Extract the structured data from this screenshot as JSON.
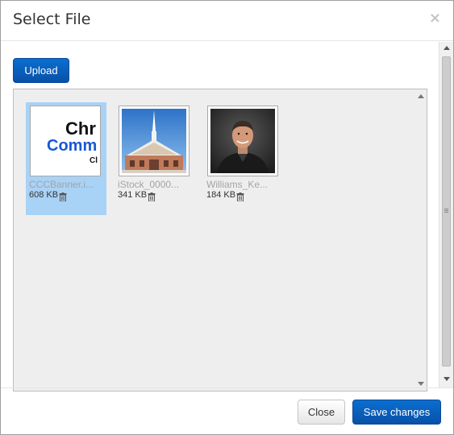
{
  "dialog": {
    "title": "Select File",
    "close_glyph": "×"
  },
  "toolbar": {
    "upload_label": "Upload"
  },
  "files": [
    {
      "name": "CCCBanner.i...",
      "size": "608 KB",
      "selected": true,
      "thumb_icon": "banner-image",
      "thumb_text_line1": "Chr",
      "thumb_text_line2": "Comm",
      "thumb_text_line3": "Cl"
    },
    {
      "name": "iStock_0000...",
      "size": "341 KB",
      "selected": false,
      "thumb_icon": "church-photo"
    },
    {
      "name": "Williams_Ke...",
      "size": "184 KB",
      "selected": false,
      "thumb_icon": "portrait-photo"
    }
  ],
  "footer": {
    "close_label": "Close",
    "save_label": "Save changes"
  },
  "colors": {
    "primary": "#0a6fcf",
    "selection": "#a8d2f6",
    "panel_bg": "#eeeeee"
  }
}
